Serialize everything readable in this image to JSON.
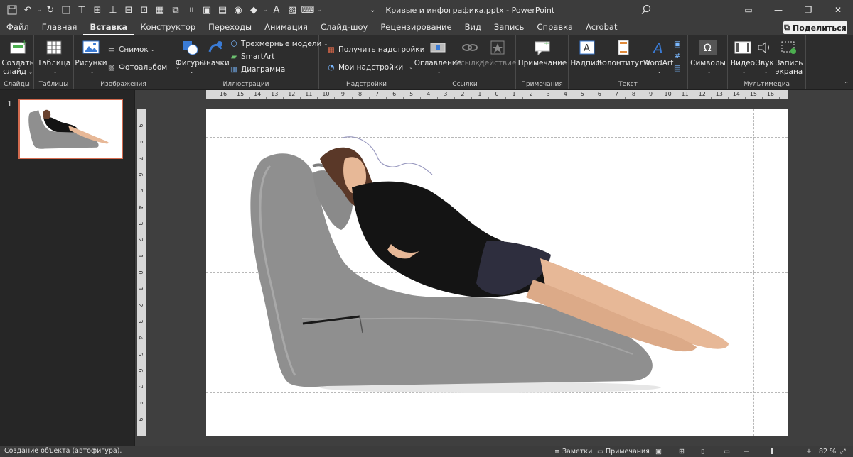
{
  "app": {
    "document_title": "Кривые и инфографика.pptx",
    "separator": "-",
    "app_name": "PowerPoint"
  },
  "tabs": [
    "Файл",
    "Главная",
    "Вставка",
    "Конструктор",
    "Переходы",
    "Анимация",
    "Слайд-шоу",
    "Рецензирование",
    "Вид",
    "Запись",
    "Справка",
    "Acrobat"
  ],
  "active_tab": "Вставка",
  "share_label": "Поделиться",
  "ribbon": {
    "slides": {
      "label": "Слайды",
      "new_slide": "Создать",
      "new_slide2": "слайд"
    },
    "tables": {
      "label": "Таблицы",
      "table": "Таблица"
    },
    "images": {
      "label": "Изображения",
      "pictures": "Рисунки",
      "screenshot": "Снимок",
      "album": "Фотоальбом"
    },
    "illustrations": {
      "label": "Иллюстрации",
      "shapes": "Фигуры",
      "icons": "Значки",
      "models3d": "Трехмерные модели",
      "smartart": "SmartArt",
      "chart": "Диаграмма"
    },
    "addins": {
      "label": "Надстройки",
      "get_addins": "Получить надстройки",
      "my_addins": "Мои надстройки"
    },
    "links": {
      "label": "Ссылки",
      "zoom": "Оглавление",
      "link": "Ссылка",
      "action": "Действие"
    },
    "comments": {
      "label": "Примечания",
      "comment": "Примечание"
    },
    "text": {
      "label": "Текст",
      "textbox": "Надпись",
      "header_footer": "Колонтитулы",
      "wordart": "WordArt"
    },
    "symbols": {
      "label": "",
      "symbols": "Символы"
    },
    "media": {
      "label": "Мультимедиа",
      "video": "Видео",
      "audio": "Звук",
      "screen_rec": "Запись",
      "screen_rec2": "экрана"
    }
  },
  "ruler_h": [
    "16",
    "15",
    "14",
    "13",
    "12",
    "11",
    "10",
    "9",
    "8",
    "7",
    "6",
    "5",
    "4",
    "3",
    "2",
    "1",
    "0",
    "1",
    "2",
    "3",
    "4",
    "5",
    "6",
    "7",
    "8",
    "9",
    "10",
    "11",
    "12",
    "13",
    "14",
    "15",
    "16"
  ],
  "ruler_v": [
    "9",
    "8",
    "7",
    "6",
    "5",
    "4",
    "3",
    "2",
    "1",
    "0",
    "1",
    "2",
    "3",
    "4",
    "5",
    "6",
    "7",
    "8",
    "9"
  ],
  "slide_number": "1",
  "status": {
    "text": "Создание объекта (автофигура).",
    "notes": "Заметки",
    "comments": "Примечания",
    "zoom": "82 %",
    "zoom_minus": "−",
    "zoom_plus": "+"
  },
  "colors": {
    "accent": "#d36b4f",
    "chrome": "#3c3c3c",
    "ribbon": "#2d2d2d",
    "couch": "#8f8f8f"
  }
}
